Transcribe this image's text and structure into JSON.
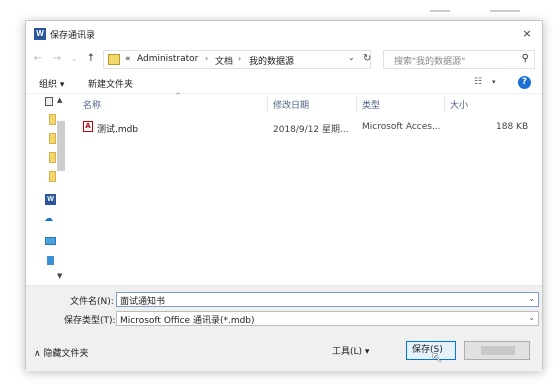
{
  "window": {
    "title": "保存通讯录",
    "close_glyph": "×",
    "app_icon": "W"
  },
  "nav": {
    "back": "←",
    "forward": "→",
    "history": "⌄",
    "up": "↑",
    "path": [
      "«",
      "Administrator",
      "文档",
      "我的数据源"
    ],
    "separator": "›",
    "refresh": "↻",
    "dropdown": "⌄",
    "search_placeholder": "搜索\"我的数据源\"",
    "search_icon": "⚲"
  },
  "toolbar": {
    "organize": "组织 ▾",
    "new_folder": "新建文件夹",
    "view_glyph": "☷",
    "view_dropdown": "▾",
    "help": "?"
  },
  "columns": {
    "name": "名称",
    "modified": "修改日期",
    "type": "类型",
    "size": "大小",
    "sort": "^"
  },
  "files": [
    {
      "name": "测试.mdb",
      "modified": "2018/9/12 星期...",
      "type": "Microsoft Acces...",
      "size": "188 KB",
      "icon": "mdb-file-icon",
      "icon_glyph": "A"
    }
  ],
  "form": {
    "filename_label": "文件名(N):",
    "filename_value": "面试通知书",
    "filetype_label": "保存类型(T):",
    "filetype_value": "Microsoft Office 通讯录(*.mdb)",
    "drop": "⌄"
  },
  "footer": {
    "hide_folders": "∧ 隐藏文件夹",
    "tools": "工具(L)  ▾",
    "save": "保存(S)",
    "cursor": "↖"
  },
  "nav_pane": {
    "up": "▲",
    "down": "▼",
    "word": "W",
    "cloud": "☁"
  },
  "colors": {
    "accent": "#0078d7",
    "header_text": "#4d6185",
    "word_blue": "#2b579a"
  }
}
